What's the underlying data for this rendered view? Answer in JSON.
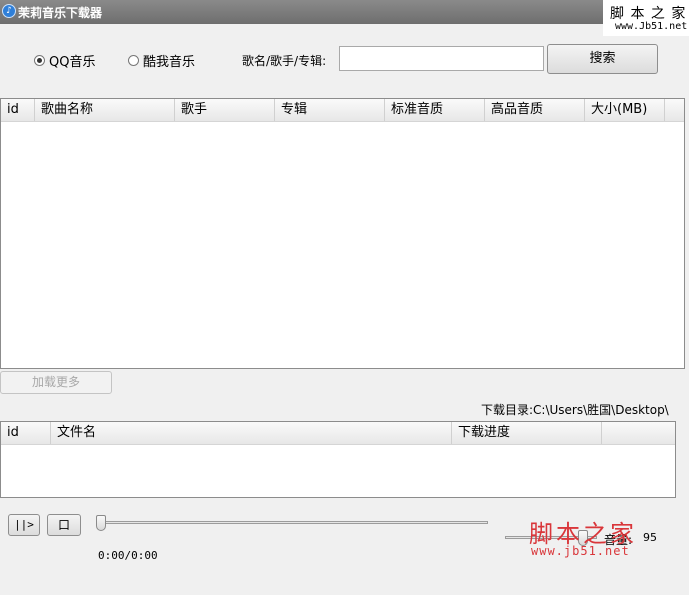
{
  "window": {
    "title": "茉莉音乐下载器",
    "icon": "music-app-icon"
  },
  "watermark": {
    "top_text": "脚 本 之 家",
    "top_url": "www.Jb51.net",
    "bottom_text": "脚本之家",
    "bottom_url": "www.jb51.net"
  },
  "search": {
    "sources": [
      {
        "label": "QQ音乐",
        "selected": true
      },
      {
        "label": "酷我音乐",
        "selected": false
      }
    ],
    "field_label": "歌名/歌手/专辑:",
    "query": "",
    "button": "搜索"
  },
  "results": {
    "columns": [
      "id",
      "歌曲名称",
      "歌手",
      "专辑",
      "标准音质",
      "高品音质",
      "大小(MB)"
    ],
    "rows": []
  },
  "load_more": "加载更多",
  "download": {
    "dir_label": "下载目录:C:\\Users\\胜国\\Desktop\\",
    "columns": [
      "id",
      "文件名",
      "下载进度"
    ],
    "rows": []
  },
  "player": {
    "play_pause_glyph": "||>",
    "stop_glyph": "口",
    "position": 0,
    "time": "0:00/0:00",
    "volume_label": "音量:",
    "volume": "95"
  }
}
